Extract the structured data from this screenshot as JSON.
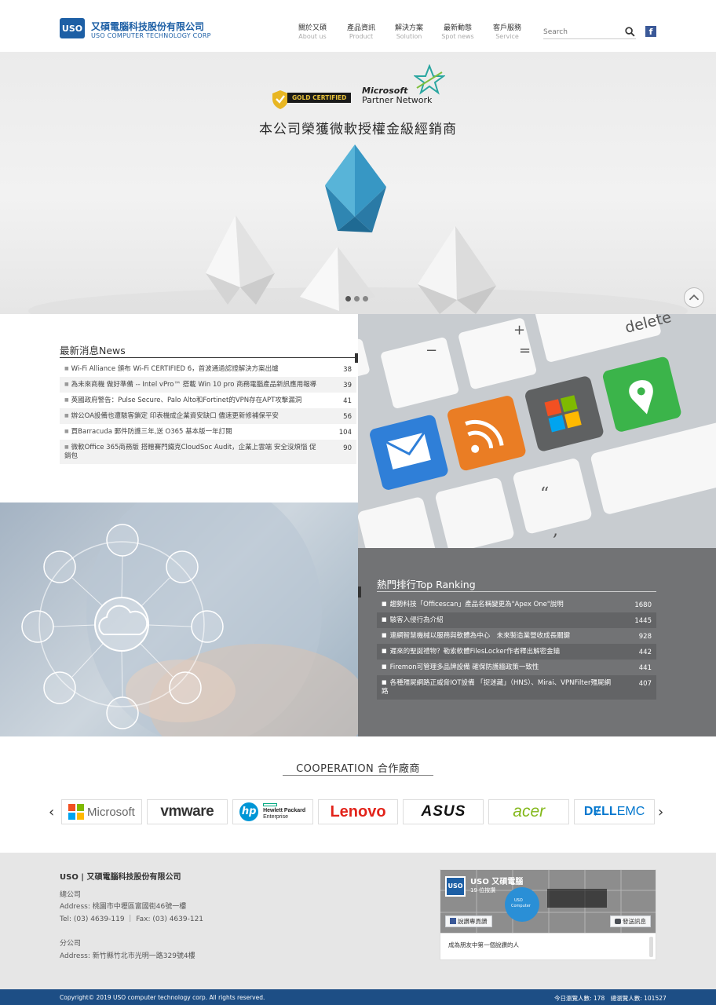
{
  "header": {
    "logo_mark": "USO",
    "company_zh": "又碩電腦科技股份有限公司",
    "company_en": "USO COMPUTER TECHNOLOGY CORP",
    "nav": [
      {
        "zh": "關於又碩",
        "en": "About us"
      },
      {
        "zh": "產品資訊",
        "en": "Product"
      },
      {
        "zh": "解決方案",
        "en": "Solution"
      },
      {
        "zh": "最新動態",
        "en": "Spot news"
      },
      {
        "zh": "客戶服務",
        "en": "Service"
      }
    ],
    "search_placeholder": "Search",
    "facebook_icon": "f"
  },
  "hero": {
    "badge_text": "GOLD CERTIFIED",
    "partner_line1": "Microsoft",
    "partner_line2": "Partner Network",
    "title": "本公司榮獲微軟授權金級經銷商",
    "slides": 3,
    "active_slide": 1
  },
  "news": {
    "title": "最新消息News",
    "items": [
      {
        "text": "Wi-Fi Alliance 頒布 Wi-Fi CERTIFIED 6，首波通過認證解決方案出爐",
        "count": "38"
      },
      {
        "text": "為未來商機 做好準備 -- Intel vPro™ 搭載 Win 10 pro 商務電腦產品新訊應用報導",
        "count": "39"
      },
      {
        "text": "英國政府警告：Pulse Secure、Palo Alto和Fortinet的VPN存在APT攻擊漏洞",
        "count": "41"
      },
      {
        "text": "辦公OA設備也遭駭客鎖定 印表機成企業資安缺口 儘速更新修補保平安",
        "count": "56"
      },
      {
        "text": "買Barracuda 郵件防護三年,送 O365 基本版一年訂閱",
        "count": "104"
      },
      {
        "text": "微軟Office 365商務版 搭贈賽門鐵克CloudSoc Audit，企業上雲端 安全沒煩惱 促銷包",
        "count": "90"
      }
    ]
  },
  "ranking": {
    "title": "熱門排行Top Ranking",
    "items": [
      {
        "text": "趨勢科技「Officescan」產品名稱變更為\"Apex One\"說明",
        "count": "1680"
      },
      {
        "text": "駭客入侵行為介紹",
        "count": "1445"
      },
      {
        "text": "連網智慧機械以服務與軟體為中心　未來製造業營收成長關鍵",
        "count": "928"
      },
      {
        "text": "遲來的聖誕禮物？勒索軟體FilesLocker作者釋出解密金鑰",
        "count": "442"
      },
      {
        "text": "Firemon可管理多品牌設備 確保防護牆政策一致性",
        "count": "441"
      },
      {
        "text": "各種殭屍網路正威脅IOT設備 「捉迷藏」（HNS）、Mirai、VPNFilter殭屍網路",
        "count": "407"
      }
    ]
  },
  "keyboard": {
    "key_delete": "delete",
    "key_plus": "+",
    "key_eq": "=",
    "key_minus": "−",
    "key_quote": "“",
    "key_comma": ","
  },
  "cooperation": {
    "title": "COOPERATION 合作廠商",
    "prev": "‹",
    "next": "›",
    "brands": [
      "Microsoft",
      "vmware",
      "hp",
      "Hewlett Packard Enterprise",
      "Lenovo",
      "ASUS",
      "acer",
      "DELL EMC"
    ],
    "hpe_line1": "Hewlett Packard",
    "hpe_line2": "Enterprise",
    "dell": "DɆLL",
    "emc": "EMC"
  },
  "footer": {
    "company": "USO | 又碩電腦科技股份有限公司",
    "hq_label": "總公司",
    "hq_address": "Address: 桃園市中壢區富國街46號一樓",
    "hq_phone": "Tel: (03) 4639-119 ｜ Fax: (03) 4639-121",
    "branch_label": "分公司",
    "branch_address": "Address: 新竹縣竹北市光明一路329號4樓",
    "fb_page_name": "USO 又碩電腦",
    "fb_likes": "19 位按讚",
    "fb_like_button": "說讚專頁讚",
    "fb_message_button": "發送訊息",
    "fb_post_text": "成為朋友中第一個說讚的人",
    "fb_badge_line1": "USO",
    "fb_badge_line2": "Computer"
  },
  "copyright": {
    "text": "Copyright© 2019 USO computer technology corp. All rights reserved.",
    "visitors": "今日瀏覽人數: 178　總瀏覽人數: 101527"
  },
  "colors": {
    "brand_blue": "#1d5fa5",
    "footer_bar": "#1d4e85",
    "ranking_bg": "#727375"
  }
}
